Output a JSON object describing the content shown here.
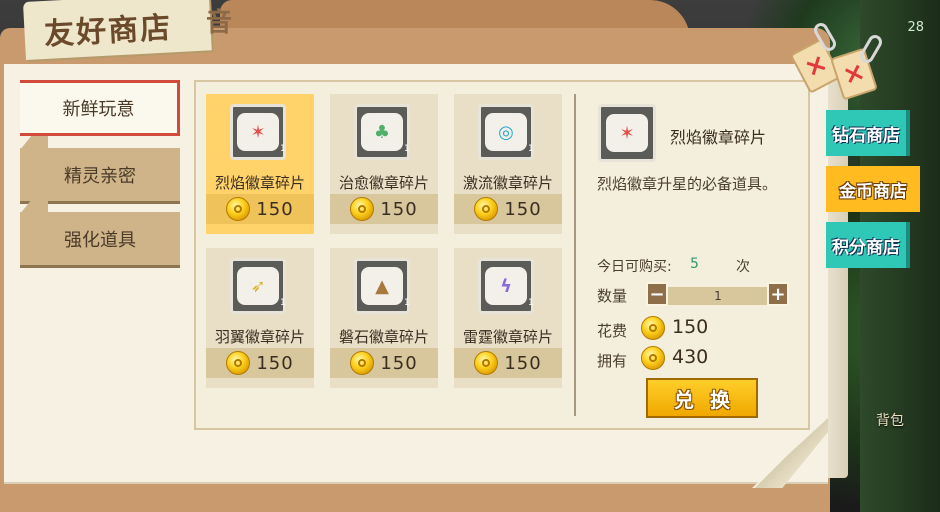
{
  "title": "友好商店",
  "title_ghost": "音",
  "background": {
    "right_label": "28",
    "bag_label": "背包"
  },
  "categories": [
    {
      "label": "新鲜玩意",
      "active": true
    },
    {
      "label": "精灵亲密",
      "active": false
    },
    {
      "label": "强化道具",
      "active": false
    }
  ],
  "items": [
    {
      "name": "烈焰徽章碎片",
      "price": "150",
      "count": "1",
      "color": "#e0524a",
      "glyph": "✶",
      "selected": true
    },
    {
      "name": "治愈徽章碎片",
      "price": "150",
      "count": "1",
      "color": "#4fb06a",
      "glyph": "♣",
      "selected": false
    },
    {
      "name": "激流徽章碎片",
      "price": "150",
      "count": "1",
      "color": "#2aa8c8",
      "glyph": "◎",
      "selected": false
    },
    {
      "name": "羽翼徽章碎片",
      "price": "150",
      "count": "1",
      "color": "#d9b22e",
      "glyph": "➶",
      "selected": false
    },
    {
      "name": "磐石徽章碎片",
      "price": "150",
      "count": "1",
      "color": "#a67a3e",
      "glyph": "▲",
      "selected": false
    },
    {
      "name": "雷霆徽章碎片",
      "price": "150",
      "count": "1",
      "color": "#8a6ad8",
      "glyph": "ϟ",
      "selected": false
    }
  ],
  "detail": {
    "name": "烈焰徽章碎片",
    "description": "烈焰徽章升星的必备道具。",
    "daily_limit_label": "今日可购买:",
    "daily_limit_value": "5",
    "daily_limit_unit": "次",
    "quantity_label": "数量",
    "quantity_value": "1",
    "minus": "−",
    "plus": "+",
    "cost_label": "花费",
    "cost_value": "150",
    "owned_label": "拥有",
    "owned_value": "430",
    "exchange_label": "兑换"
  },
  "store_tabs": [
    {
      "label": "钻石商店",
      "active": false
    },
    {
      "label": "金币商店",
      "active": true
    },
    {
      "label": "积分商店",
      "active": false
    }
  ],
  "close_marks": [
    "×",
    "×"
  ],
  "colors": {
    "accent_gold": "#ffbb1f",
    "teal_tab": "#2fc7b6",
    "selected_card": "#ffd36a",
    "active_border": "#d24a3a",
    "limit_value": "#2d9a6e"
  }
}
